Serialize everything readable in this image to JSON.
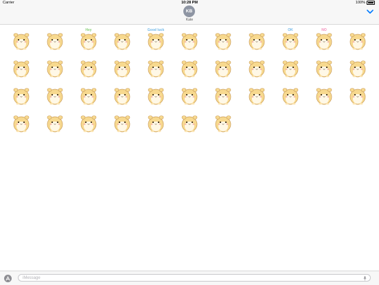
{
  "status_bar": {
    "carrier": "Carrier",
    "time": "10:28 PM",
    "battery": "100%"
  },
  "header": {
    "avatar_initials": "KB",
    "contact_name": "Kate"
  },
  "message_input": {
    "placeholder": "iMessage"
  },
  "colors": {
    "accent": "#007aff",
    "fur": "#f7d98f",
    "belly": "#fff8e6",
    "outline": "#c99a55"
  },
  "stickers": [
    {
      "name": "hamster-sticker-1",
      "text": ""
    },
    {
      "name": "hamster-sticker-2",
      "text": ""
    },
    {
      "name": "hamster-sticker-3",
      "text": "Hey"
    },
    {
      "name": "hamster-sticker-4",
      "text": ""
    },
    {
      "name": "hamster-sticker-5",
      "text": "Good luck"
    },
    {
      "name": "hamster-sticker-6",
      "text": ""
    },
    {
      "name": "hamster-sticker-7",
      "text": ""
    },
    {
      "name": "hamster-sticker-8",
      "text": ""
    },
    {
      "name": "hamster-sticker-9",
      "text": "OK"
    },
    {
      "name": "hamster-sticker-10",
      "text": "NO"
    },
    {
      "name": "hamster-sticker-11",
      "text": ""
    },
    {
      "name": "hamster-sticker-12",
      "text": ""
    },
    {
      "name": "hamster-sticker-13",
      "text": ""
    },
    {
      "name": "hamster-sticker-14",
      "text": ""
    },
    {
      "name": "hamster-sticker-15",
      "text": ""
    },
    {
      "name": "hamster-sticker-16",
      "text": ""
    },
    {
      "name": "hamster-sticker-17",
      "text": ""
    },
    {
      "name": "hamster-sticker-18",
      "text": ""
    },
    {
      "name": "hamster-sticker-19",
      "text": ""
    },
    {
      "name": "hamster-sticker-20",
      "text": ""
    },
    {
      "name": "hamster-sticker-21",
      "text": ""
    },
    {
      "name": "hamster-sticker-22",
      "text": ""
    },
    {
      "name": "hamster-sticker-23",
      "text": ""
    },
    {
      "name": "hamster-sticker-24",
      "text": ""
    },
    {
      "name": "hamster-sticker-25",
      "text": ""
    },
    {
      "name": "hamster-sticker-26",
      "text": ""
    },
    {
      "name": "hamster-sticker-27",
      "text": ""
    },
    {
      "name": "hamster-sticker-28",
      "text": ""
    },
    {
      "name": "hamster-sticker-29",
      "text": ""
    },
    {
      "name": "hamster-sticker-30",
      "text": ""
    },
    {
      "name": "hamster-sticker-31",
      "text": ""
    },
    {
      "name": "hamster-sticker-32",
      "text": ""
    },
    {
      "name": "hamster-sticker-33",
      "text": ""
    },
    {
      "name": "hamster-sticker-34",
      "text": ""
    },
    {
      "name": "hamster-sticker-35",
      "text": ""
    },
    {
      "name": "hamster-sticker-36",
      "text": ""
    },
    {
      "name": "hamster-sticker-37",
      "text": ""
    },
    {
      "name": "hamster-sticker-38",
      "text": ""
    },
    {
      "name": "hamster-sticker-39",
      "text": ""
    },
    {
      "name": "hamster-sticker-40",
      "text": ""
    }
  ]
}
